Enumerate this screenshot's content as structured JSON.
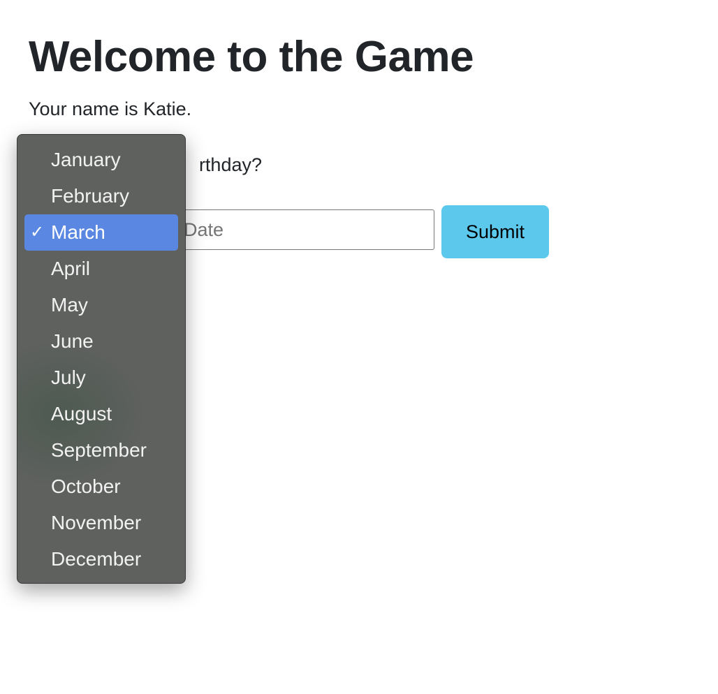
{
  "page": {
    "title": "Welcome to the Game",
    "name_text": "Your name is Katie.",
    "question_visible": "rthday?",
    "date_placeholder": "Date",
    "submit_label": "Submit"
  },
  "month_menu": {
    "selected": "March",
    "check_glyph": "✓",
    "items": [
      "January",
      "February",
      "March",
      "April",
      "May",
      "June",
      "July",
      "August",
      "September",
      "October",
      "November",
      "December"
    ]
  },
  "colors": {
    "submit": "#5bc8ec",
    "selection": "#5a87e2",
    "menu_bg": "#616260"
  }
}
